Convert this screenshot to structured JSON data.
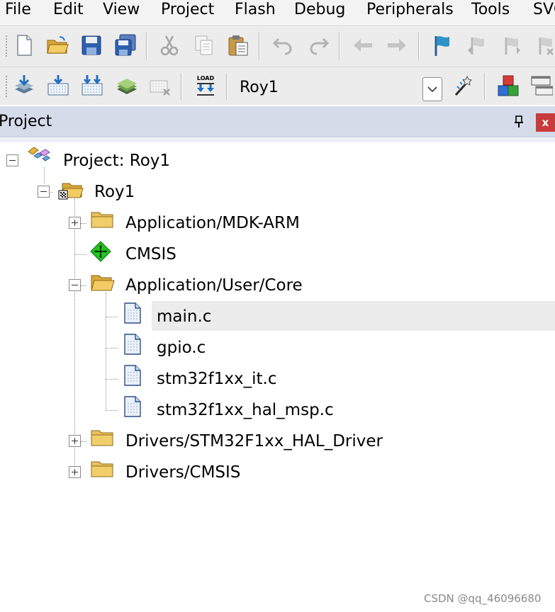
{
  "menu": [
    "File",
    "Edit",
    "View",
    "Project",
    "Flash",
    "Debug",
    "Peripherals",
    "Tools",
    "SVC"
  ],
  "toolbar1": {
    "icons": [
      "new-file-icon",
      "open-folder-icon",
      "save-icon",
      "save-all-icon",
      "cut-icon",
      "copy-icon",
      "paste-icon",
      "undo-icon",
      "redo-icon",
      "navigate-back-icon",
      "navigate-forward-icon",
      "bookmark-icon",
      "prev-bookmark-icon",
      "next-bookmark-icon",
      "clear-bookmarks-icon"
    ]
  },
  "toolbar2": {
    "icons": [
      "translate-icon",
      "build-icon",
      "rebuild-icon",
      "batch-build-icon",
      "stop-build-icon",
      "download-icon",
      "target-options-icon",
      "manage-components-icon",
      "window-layout-icon"
    ],
    "load_label": "LOAD",
    "target_name": "Roy1"
  },
  "panel": {
    "title": "Project",
    "close_label": "x"
  },
  "tree": {
    "project_label": "Project: Roy1",
    "target_label": "Roy1",
    "groups": [
      "Application/MDK-ARM",
      "CMSIS",
      "Application/User/Core",
      "Drivers/STM32F1xx_HAL_Driver",
      "Drivers/CMSIS"
    ],
    "files": [
      "main.c",
      "gpio.c",
      "stm32f1xx_it.c",
      "stm32f1xx_hal_msp.c"
    ],
    "selected_file": "main.c"
  },
  "watermark": "CSDN @qq_46096680",
  "colors": {
    "panel_header": "#d6dbe9",
    "close_button": "#c83b3b",
    "folder": "#e8c25a",
    "cmsis_diamond": "#21c421",
    "selected_row": "#ececec"
  }
}
